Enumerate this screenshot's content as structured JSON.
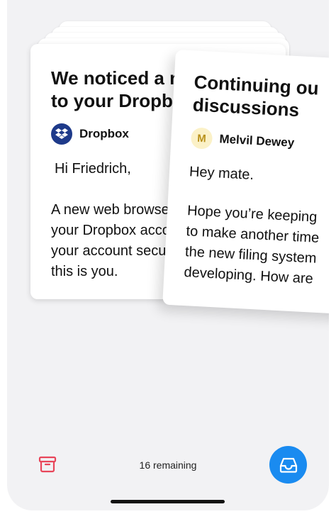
{
  "cards": [
    {
      "title_lines": [
        "We noticed a ne",
        "to your Dropbox"
      ],
      "sender": "Dropbox",
      "greeting": "Hi Friedrich,",
      "body_lines": [
        "A new web browser",
        "your Dropbox accou",
        "your account secur",
        "this is you."
      ],
      "avatar_icon": "dropbox-logo-icon"
    },
    {
      "title_lines": [
        "Continuing ou",
        "discussions"
      ],
      "sender": "Melvil Dewey",
      "avatar_initial": "M",
      "greeting": "Hey mate.",
      "body_lines": [
        "Hope you’re keeping",
        "to make another time",
        "the new filing system",
        "developing. How are"
      ]
    }
  ],
  "footer": {
    "remaining_label": "16 remaining",
    "archive_icon": "archive-icon",
    "inbox_icon": "inbox-icon"
  },
  "colors": {
    "accent": "#1a8bf0",
    "archive": "#e8465a",
    "dropbox": "#1e3a8a",
    "avatar_m_bg": "#fbf1c7",
    "avatar_m_fg": "#b9911a"
  }
}
